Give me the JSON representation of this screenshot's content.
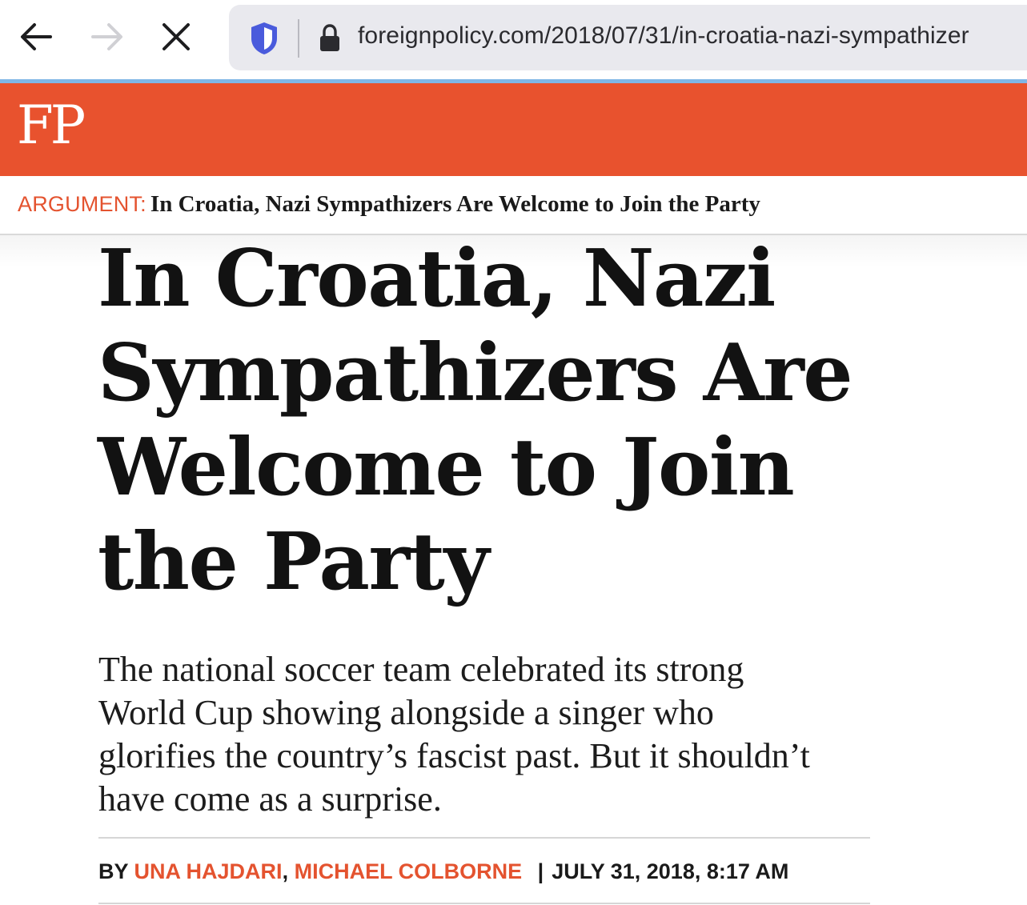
{
  "browser": {
    "url": "foreignpolicy.com/2018/07/31/in-croatia-nazi-sympathizer",
    "icons": {
      "back": "arrow-left-icon",
      "forward": "arrow-right-icon",
      "stop": "close-icon",
      "tracking": "shield-icon",
      "security": "lock-icon"
    },
    "colors": {
      "urlbar_bg": "#e9e9ee",
      "shield": "#4a5bdc",
      "loadbar": "#7fb6e6"
    }
  },
  "site": {
    "logo": "FP",
    "brand_color": "#e8522e"
  },
  "breadcrumb": {
    "kicker": "ARGUMENT:",
    "title": "In Croatia, Nazi Sympathizers Are Welcome to Join the Party"
  },
  "article": {
    "headline": "In Croatia, Nazi Sympathizers Are Welcome to Join the Party",
    "dek": "The national soccer team celebrated its strong World Cup showing alongside a singer who glorifies the country’s fascist past. But it shouldn’t have come as a surprise.",
    "byline": {
      "prefix": "BY",
      "authors": [
        "UNA HAJDARI",
        "MICHAEL COLBORNE"
      ],
      "author_separator": ",",
      "divider": "|",
      "date": "JULY 31, 2018, 8:17 AM"
    },
    "accent_color": "#e4532f"
  }
}
